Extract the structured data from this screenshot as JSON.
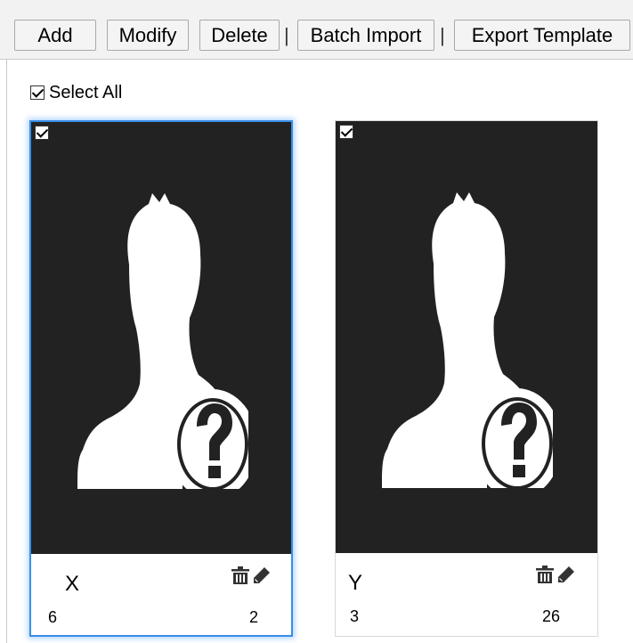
{
  "toolbar": {
    "add_label": "Add",
    "modify_label": "Modify",
    "delete_label": "Delete",
    "batch_import_label": "Batch Import",
    "export_template_label": "Export Template",
    "separator": "|"
  },
  "select_all": {
    "label": "Select All",
    "checked": true
  },
  "cards": [
    {
      "name": "X",
      "id": "6",
      "number": "2",
      "checked": true,
      "selected": true
    },
    {
      "name": "Y",
      "id": "3",
      "number": "26",
      "checked": true,
      "selected": false
    }
  ],
  "icons": [
    "checkbox-checked-icon",
    "person-unknown-icon",
    "trash-icon",
    "pencil-icon"
  ],
  "colors": {
    "photo_bg": "#222222",
    "selection_border": "#3a8ee6",
    "toolbar_bg": "#f2f2f2"
  }
}
